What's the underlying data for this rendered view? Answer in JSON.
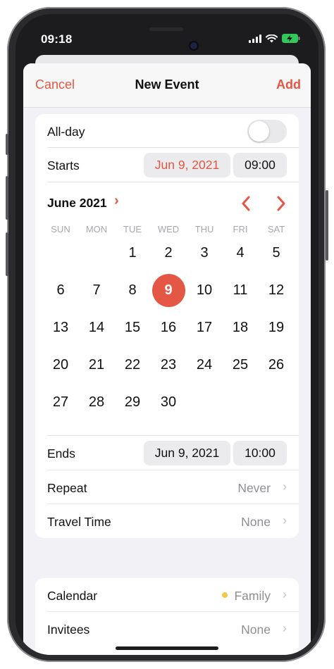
{
  "status": {
    "time": "09:18"
  },
  "nav": {
    "cancel": "Cancel",
    "title": "New Event",
    "add": "Add"
  },
  "allday": {
    "label": "All-day",
    "on": false
  },
  "starts": {
    "label": "Starts",
    "date": "Jun 9, 2021",
    "time": "09:00"
  },
  "calendar": {
    "month_label": "June 2021",
    "weekdays": [
      "SUN",
      "MON",
      "TUE",
      "WED",
      "THU",
      "FRI",
      "SAT"
    ],
    "weeks": [
      [
        "",
        "",
        "1",
        "2",
        "3",
        "4",
        "5"
      ],
      [
        "6",
        "7",
        "8",
        "9",
        "10",
        "11",
        "12"
      ],
      [
        "13",
        "14",
        "15",
        "16",
        "17",
        "18",
        "19"
      ],
      [
        "20",
        "21",
        "22",
        "23",
        "24",
        "25",
        "26"
      ],
      [
        "27",
        "28",
        "29",
        "30",
        "",
        "",
        ""
      ]
    ],
    "selected_day": "9"
  },
  "ends": {
    "label": "Ends",
    "date": "Jun 9, 2021",
    "time": "10:00"
  },
  "repeat": {
    "label": "Repeat",
    "value": "Never"
  },
  "travel": {
    "label": "Travel Time",
    "value": "None"
  },
  "calendar_field": {
    "label": "Calendar",
    "value": "Family",
    "dot_color": "#f6c844"
  },
  "invitees": {
    "label": "Invitees",
    "value": "None"
  },
  "colors": {
    "accent": "#e35744"
  }
}
